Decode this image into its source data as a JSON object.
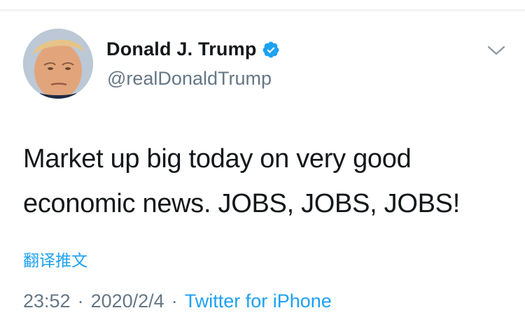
{
  "tweet": {
    "author": {
      "display_name": "Donald J. Trump",
      "handle": "@realDonaldTrump",
      "verified": true
    },
    "text_lines": [
      "Market up big today on very good",
      "economic news. JOBS, JOBS, JOBS!"
    ],
    "translate_label": "翻译推文",
    "time": "23:52",
    "separator": "·",
    "date": "2020/2/4",
    "source": "Twitter for iPhone"
  },
  "icons": {
    "verified": "verified-badge-icon",
    "more": "chevron-down-icon"
  },
  "colors": {
    "accent": "#1da1f2",
    "text": "#14171a",
    "secondary": "#657786"
  }
}
